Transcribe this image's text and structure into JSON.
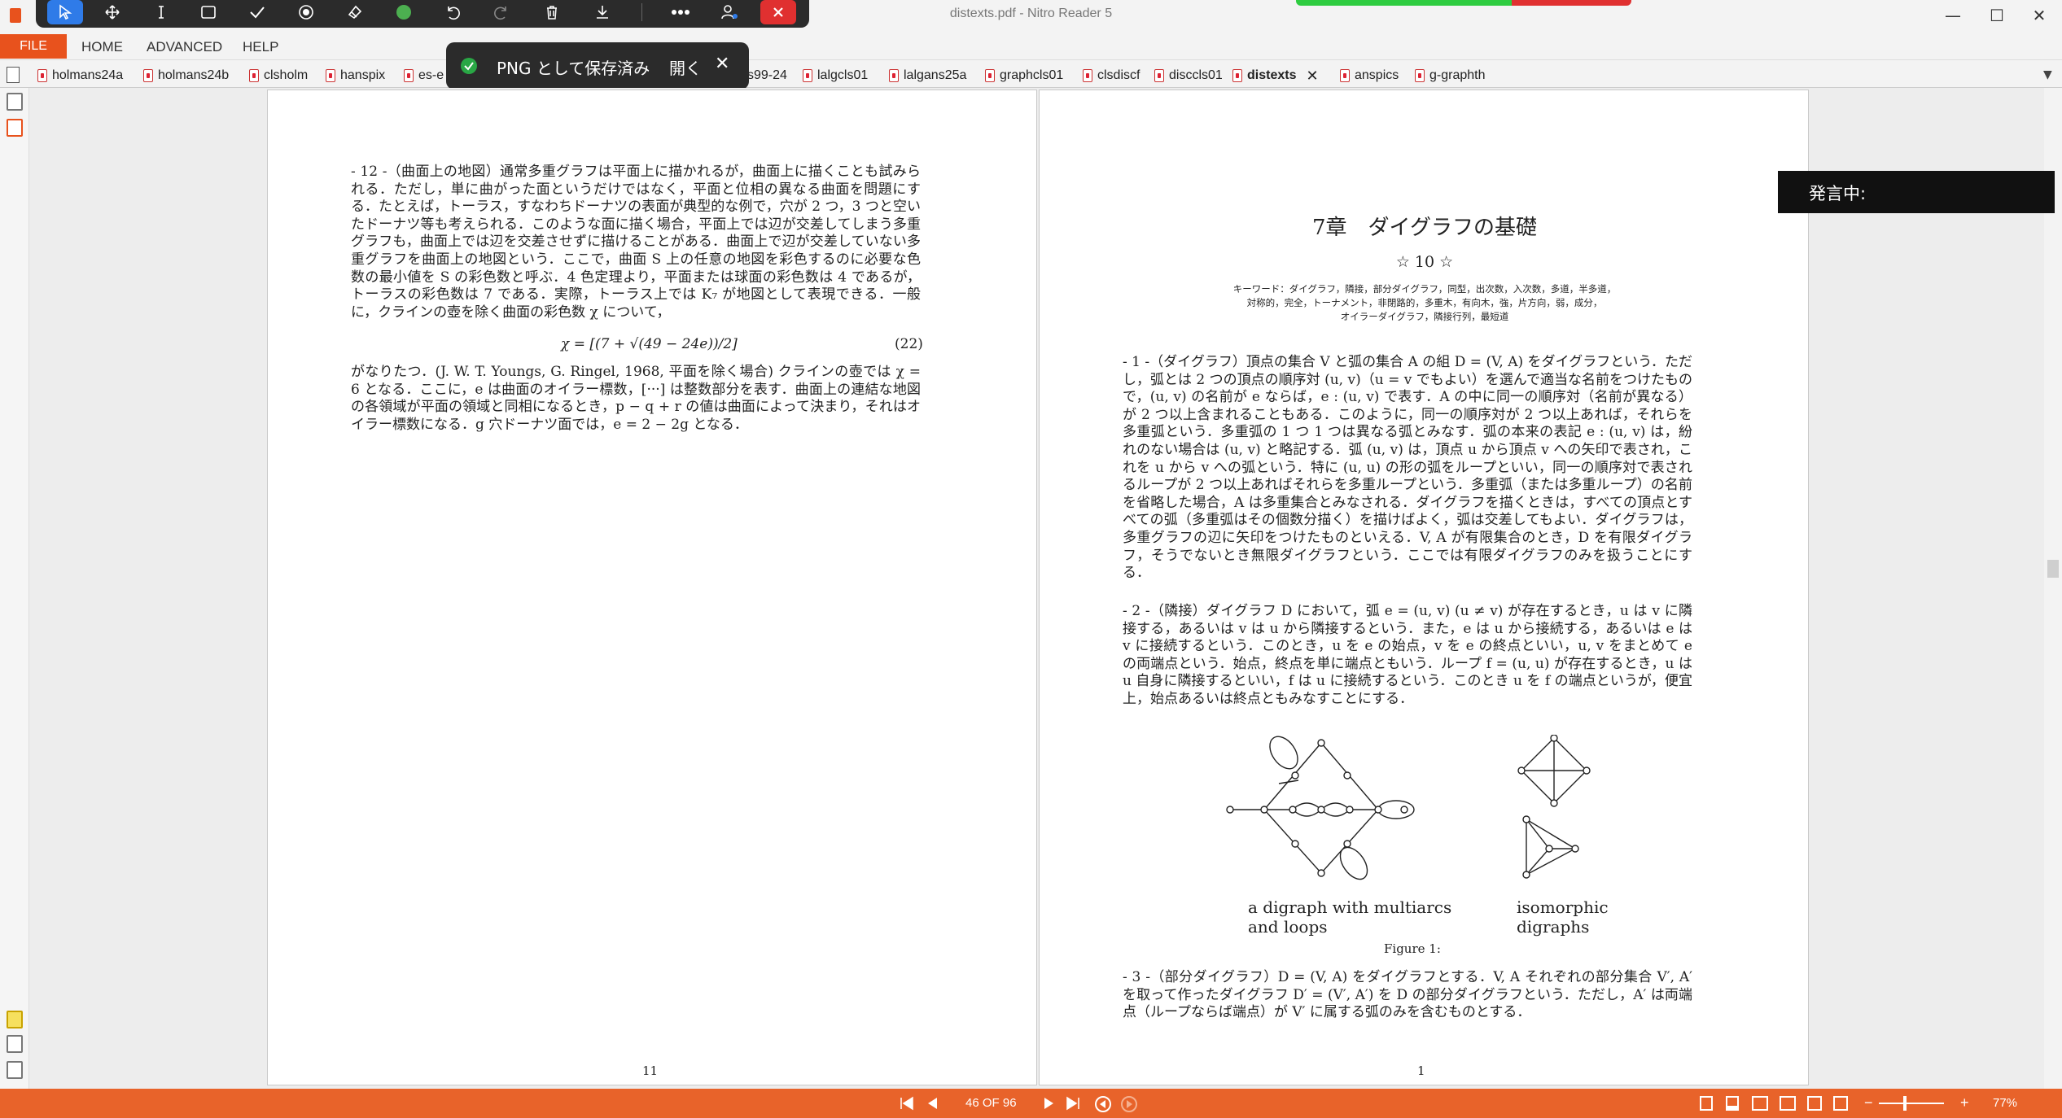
{
  "window": {
    "title": "distexts.pdf - Nitro Reader 5",
    "minimize": "—",
    "maximize": "☐",
    "close": "✕"
  },
  "annotation_toolbar": {
    "tools": [
      "select-cursor",
      "move",
      "text",
      "rectangle",
      "check",
      "spray",
      "eraser",
      "color",
      "undo",
      "redo",
      "delete",
      "save",
      "more",
      "share",
      "close"
    ],
    "color_swatch": "#4caf50"
  },
  "menu": {
    "file": "FILE",
    "home": "HOME",
    "advanced": "ADVANCED",
    "help": "HELP"
  },
  "toast": {
    "message": "PNG として保存済み",
    "open": "開く",
    "close": "✕"
  },
  "tabs": [
    {
      "label": "holmans24a"
    },
    {
      "label": "holmans24b"
    },
    {
      "label": "clsholm"
    },
    {
      "label": "hanspix"
    },
    {
      "label": "es-e"
    },
    {
      "label": "s99-24"
    },
    {
      "label": "lalgcls01"
    },
    {
      "label": "lalgans25a"
    },
    {
      "label": "graphcls01"
    },
    {
      "label": "clsdiscf"
    },
    {
      "label": "disccls01"
    },
    {
      "label": "distexts",
      "active": true
    },
    {
      "label": "anspics"
    },
    {
      "label": "g-graphth"
    }
  ],
  "tab_close": "✕",
  "left_page": {
    "para1": "- 12 -（曲面上の地図）通常多重グラフは平面上に描かれるが，曲面上に描くことも試みられる．ただし，単に曲がった面というだけではなく，平面と位相の異なる曲面を問題にする．たとえば，トーラス，すなわちドーナツの表面が典型的な例で，穴が 2 つ，3 つと空いたドーナツ等も考えられる．このような面に描く場合，平面上では辺が交差してしまう多重グラフも，曲面上では辺を交差させずに描けることがある．曲面上で辺が交差していない多重グラフを曲面上の地図という．ここで，曲面 S 上の任意の地図を彩色するのに必要な色数の最小値を S の彩色数と呼ぶ．4 色定理より，平面または球面の彩色数は 4 であるが，トーラスの彩色数は 7 である．実際，トーラス上では K₇ が地図として表現できる．一般に，クラインの壺を除く曲面の彩色数 χ について，",
    "equation": "χ = [(7 + √(49 − 24e))/2]",
    "equation_number": "(22)",
    "para2": "がなりたつ．(J. W. T. Youngs, G. Ringel, 1968, 平面を除く場合) クラインの壺では χ = 6 となる．ここに，e は曲面のオイラー標数，[···] は整数部分を表す．曲面上の連結な地図の各領域が平面の領域と同相になるとき，p − q + r の値は曲面によって決まり，それはオイラー標数になる．g 穴ドーナツ面では，e = 2 − 2g となる．",
    "page_number": "11"
  },
  "right_page": {
    "chapter_title": "7章　ダイグラフの基礎",
    "stars": "☆ 10 ☆",
    "keywords_line1": "キーワード：ダイグラフ，隣接，部分ダイグラフ，同型，出次数，入次数，多道，半多道，",
    "keywords_line2": "対称的，完全，トーナメント，非閉路的，多重木，有向木，強，片方向，弱，成分，",
    "keywords_line3": "オイラーダイグラフ，隣接行列，最短道",
    "para1": "- 1 -（ダイグラフ）頂点の集合 V と弧の集合 A の組 D = (V, A) をダイグラフという．ただし，弧とは 2 つの頂点の順序対 (u, v)（u = v でもよい）を選んで適当な名前をつけたもので，(u, v) の名前が e ならば，e : (u, v) で表す．A の中に同一の順序対（名前が異なる）が 2 つ以上含まれることもある．このように，同一の順序対が 2 つ以上あれば，それらを多重弧という．多重弧の 1 つ 1 つは異なる弧とみなす．弧の本来の表記 e : (u, v) は，紛れのない場合は (u, v) と略記する．弧 (u, v) は，頂点 u から頂点 v への矢印で表され，これを u から v への弧という．特に (u, u) の形の弧をループといい，同一の順序対で表されるループが 2 つ以上あればそれらを多重ループという．多重弧（または多重ループ）の名前を省略した場合，A は多重集合とみなされる．ダイグラフを描くときは，すべての頂点とすべての弧（多重弧はその個数分描く）を描けばよく，弧は交差してもよい．ダイグラフは，多重グラフの辺に矢印をつけたものといえる．V, A が有限集合のとき，D を有限ダイグラフ，そうでないとき無限ダイグラフという．ここでは有限ダイグラフのみを扱うことにする．",
    "para2": "- 2 -（隣接）ダイグラフ D において，弧 e = (u, v) (u ≠ v) が存在するとき，u は v に隣接する，あるいは v は u から隣接するという．また，e は u から接続する，あるいは e は v に接続するという．このとき，u を e の始点，v を e の終点といい，u, v をまとめて e の両端点という．始点，終点を単に端点ともいう．ループ f = (u, u) が存在するとき，u は u 自身に隣接するといい，f は u に接続するという．このとき u を f の端点というが，便宜上，始点あるいは終点ともみなすことにする．",
    "fig_label_left_1": "a digraph with multiarcs",
    "fig_label_left_2": "and loops",
    "fig_label_right_1": "isomorphic",
    "fig_label_right_2": "digraphs",
    "figure_caption": "Figure 1:",
    "para3": "- 3 -（部分ダイグラフ）D = (V, A) をダイグラフとする．V, A それぞれの部分集合 V′, A′ を取って作ったダイグラフ D′ = (V′, A′) を D の部分ダイグラフという．ただし，A′ は両端点（ループならば端点）が V′ に属する弧のみを含むものとする．",
    "page_number": "1"
  },
  "speech_overlay": "発言中:",
  "bottom": {
    "page_indicator": "46 OF 96",
    "zoom": "77%",
    "zoom_minus": "−",
    "zoom_plus": "+"
  },
  "colors": {
    "accent": "#e8521d",
    "bottom_bar": "#e8632a",
    "toolbar_bg": "#2b2b2b",
    "active_tool": "#2f7be8",
    "close_red": "#e03030"
  }
}
